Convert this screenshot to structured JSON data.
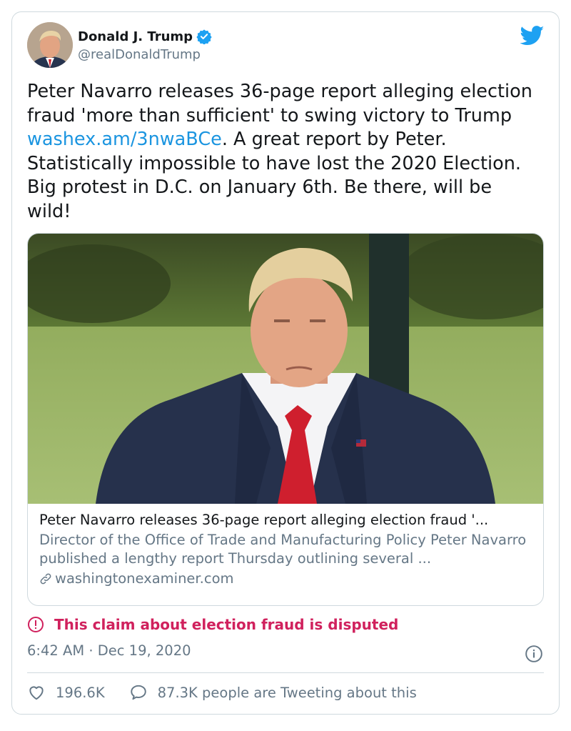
{
  "author": {
    "name": "Donald J. Trump",
    "handle": "@realDonaldTrump",
    "verified": true
  },
  "tweet": {
    "text_before_link": "Peter Navarro releases 36-page report alleging election fraud 'more than sufficient' to swing victory to Trump ",
    "link_text": "washex.am/3nwaBCe",
    "text_after_link": ". A great report by Peter. Statistically impossible to have lost the 2020 Election. Big protest in D.C. on January 6th. Be there, will be wild!"
  },
  "link_card": {
    "title": "Peter Navarro releases 36-page report alleging election fraud '...",
    "description": "Director of the Office of Trade and Manufacturing Policy Peter Navarro published a lengthy report Thursday outlining several ...",
    "domain": "washingtonexaminer.com"
  },
  "disputed_label": "This claim about election fraud is disputed",
  "timestamp": "6:42 AM · Dec 19, 2020",
  "engagement": {
    "likes": "196.6K",
    "tweeting": "87.3K people are Tweeting about this"
  },
  "icons": {
    "verified": "verified-badge-icon",
    "brand": "twitter-bird-icon",
    "warning": "exclamation-circle-icon",
    "info": "info-icon",
    "like": "heart-icon",
    "reply": "speech-bubble-icon",
    "link": "chain-link-icon"
  },
  "colors": {
    "accent": "#1da1f2",
    "link": "#1b95e0",
    "disputed": "#d0215d",
    "secondary_text": "#657786",
    "border": "#cfd9de"
  }
}
